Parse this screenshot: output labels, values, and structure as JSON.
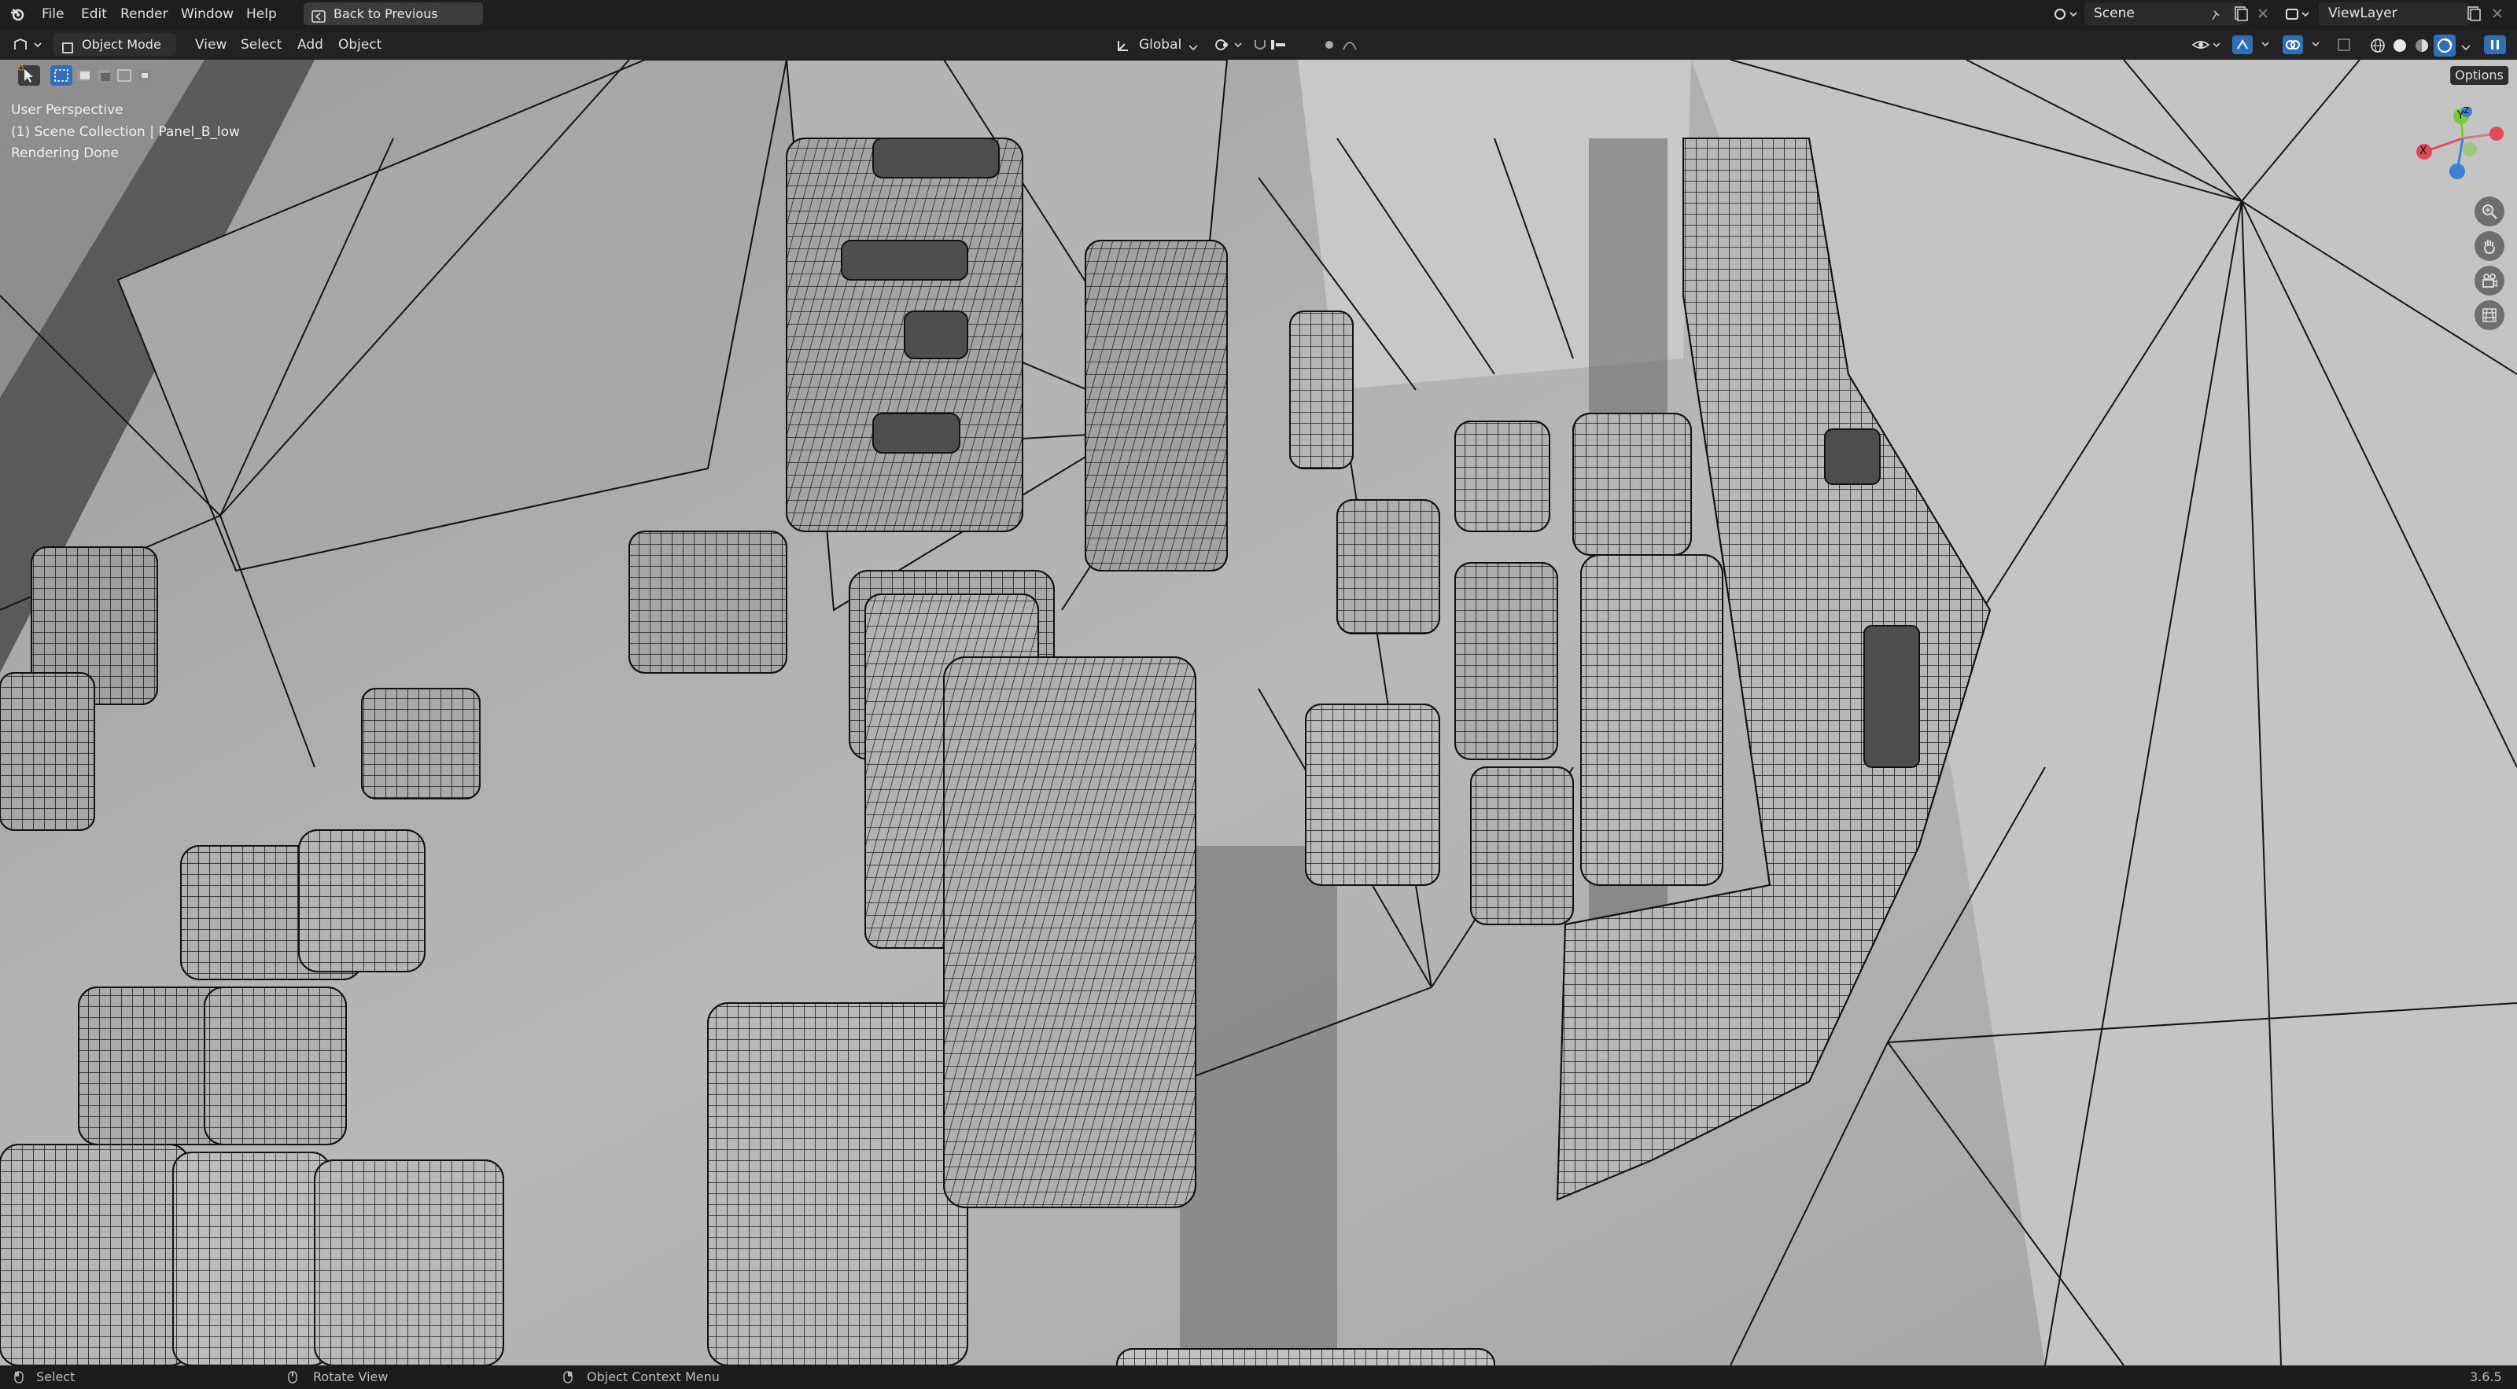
{
  "topbar": {
    "menus": [
      "File",
      "Edit",
      "Render",
      "Window",
      "Help"
    ],
    "back_button": "Back to Previous",
    "scene_name": "Scene",
    "view_layer": "ViewLayer"
  },
  "header": {
    "mode": "Object Mode",
    "menus": [
      "View",
      "Select",
      "Add",
      "Object"
    ],
    "transform_orientation": "Global",
    "options": "Options"
  },
  "viewport": {
    "perspective": "User Perspective",
    "collection": "(1) Scene Collection | Panel_B_low",
    "status": "Rendering Done",
    "gizmo_axes": {
      "x": "X",
      "y": "Y",
      "z": "Z"
    }
  },
  "statusbar": {
    "select": "Select",
    "rotate": "Rotate View",
    "context_menu": "Object Context Menu",
    "version": "3.6.5"
  },
  "colors": {
    "axis_x": "#e04a5a",
    "axis_y": "#7ec830",
    "axis_z": "#3f7fd8",
    "active_blue": "#2f6fb7"
  },
  "icons": [
    "blender-logo-icon",
    "back-icon",
    "editor-type-icon",
    "mode-icon",
    "select-box-icon",
    "pivot-icon",
    "snap-icon",
    "proportional-icon",
    "visibility-icon",
    "gizmo-icon",
    "overlay-icon",
    "xray-icon",
    "zoom-icon",
    "pan-hand-icon",
    "camera-icon",
    "grid-icon",
    "mouse-icon"
  ]
}
